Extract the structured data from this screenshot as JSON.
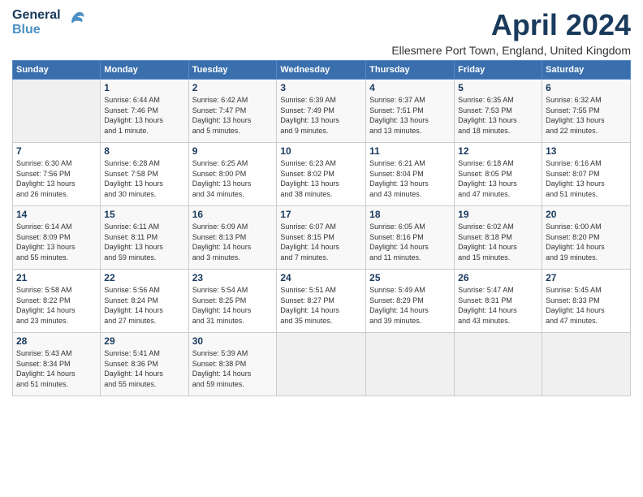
{
  "header": {
    "logo_line1": "General",
    "logo_line2": "Blue",
    "title": "April 2024",
    "location": "Ellesmere Port Town, England, United Kingdom"
  },
  "days_of_week": [
    "Sunday",
    "Monday",
    "Tuesday",
    "Wednesday",
    "Thursday",
    "Friday",
    "Saturday"
  ],
  "weeks": [
    [
      {
        "day": "",
        "info": ""
      },
      {
        "day": "1",
        "info": "Sunrise: 6:44 AM\nSunset: 7:46 PM\nDaylight: 13 hours\nand 1 minute."
      },
      {
        "day": "2",
        "info": "Sunrise: 6:42 AM\nSunset: 7:47 PM\nDaylight: 13 hours\nand 5 minutes."
      },
      {
        "day": "3",
        "info": "Sunrise: 6:39 AM\nSunset: 7:49 PM\nDaylight: 13 hours\nand 9 minutes."
      },
      {
        "day": "4",
        "info": "Sunrise: 6:37 AM\nSunset: 7:51 PM\nDaylight: 13 hours\nand 13 minutes."
      },
      {
        "day": "5",
        "info": "Sunrise: 6:35 AM\nSunset: 7:53 PM\nDaylight: 13 hours\nand 18 minutes."
      },
      {
        "day": "6",
        "info": "Sunrise: 6:32 AM\nSunset: 7:55 PM\nDaylight: 13 hours\nand 22 minutes."
      }
    ],
    [
      {
        "day": "7",
        "info": "Sunrise: 6:30 AM\nSunset: 7:56 PM\nDaylight: 13 hours\nand 26 minutes."
      },
      {
        "day": "8",
        "info": "Sunrise: 6:28 AM\nSunset: 7:58 PM\nDaylight: 13 hours\nand 30 minutes."
      },
      {
        "day": "9",
        "info": "Sunrise: 6:25 AM\nSunset: 8:00 PM\nDaylight: 13 hours\nand 34 minutes."
      },
      {
        "day": "10",
        "info": "Sunrise: 6:23 AM\nSunset: 8:02 PM\nDaylight: 13 hours\nand 38 minutes."
      },
      {
        "day": "11",
        "info": "Sunrise: 6:21 AM\nSunset: 8:04 PM\nDaylight: 13 hours\nand 43 minutes."
      },
      {
        "day": "12",
        "info": "Sunrise: 6:18 AM\nSunset: 8:05 PM\nDaylight: 13 hours\nand 47 minutes."
      },
      {
        "day": "13",
        "info": "Sunrise: 6:16 AM\nSunset: 8:07 PM\nDaylight: 13 hours\nand 51 minutes."
      }
    ],
    [
      {
        "day": "14",
        "info": "Sunrise: 6:14 AM\nSunset: 8:09 PM\nDaylight: 13 hours\nand 55 minutes."
      },
      {
        "day": "15",
        "info": "Sunrise: 6:11 AM\nSunset: 8:11 PM\nDaylight: 13 hours\nand 59 minutes."
      },
      {
        "day": "16",
        "info": "Sunrise: 6:09 AM\nSunset: 8:13 PM\nDaylight: 14 hours\nand 3 minutes."
      },
      {
        "day": "17",
        "info": "Sunrise: 6:07 AM\nSunset: 8:15 PM\nDaylight: 14 hours\nand 7 minutes."
      },
      {
        "day": "18",
        "info": "Sunrise: 6:05 AM\nSunset: 8:16 PM\nDaylight: 14 hours\nand 11 minutes."
      },
      {
        "day": "19",
        "info": "Sunrise: 6:02 AM\nSunset: 8:18 PM\nDaylight: 14 hours\nand 15 minutes."
      },
      {
        "day": "20",
        "info": "Sunrise: 6:00 AM\nSunset: 8:20 PM\nDaylight: 14 hours\nand 19 minutes."
      }
    ],
    [
      {
        "day": "21",
        "info": "Sunrise: 5:58 AM\nSunset: 8:22 PM\nDaylight: 14 hours\nand 23 minutes."
      },
      {
        "day": "22",
        "info": "Sunrise: 5:56 AM\nSunset: 8:24 PM\nDaylight: 14 hours\nand 27 minutes."
      },
      {
        "day": "23",
        "info": "Sunrise: 5:54 AM\nSunset: 8:25 PM\nDaylight: 14 hours\nand 31 minutes."
      },
      {
        "day": "24",
        "info": "Sunrise: 5:51 AM\nSunset: 8:27 PM\nDaylight: 14 hours\nand 35 minutes."
      },
      {
        "day": "25",
        "info": "Sunrise: 5:49 AM\nSunset: 8:29 PM\nDaylight: 14 hours\nand 39 minutes."
      },
      {
        "day": "26",
        "info": "Sunrise: 5:47 AM\nSunset: 8:31 PM\nDaylight: 14 hours\nand 43 minutes."
      },
      {
        "day": "27",
        "info": "Sunrise: 5:45 AM\nSunset: 8:33 PM\nDaylight: 14 hours\nand 47 minutes."
      }
    ],
    [
      {
        "day": "28",
        "info": "Sunrise: 5:43 AM\nSunset: 8:34 PM\nDaylight: 14 hours\nand 51 minutes."
      },
      {
        "day": "29",
        "info": "Sunrise: 5:41 AM\nSunset: 8:36 PM\nDaylight: 14 hours\nand 55 minutes."
      },
      {
        "day": "30",
        "info": "Sunrise: 5:39 AM\nSunset: 8:38 PM\nDaylight: 14 hours\nand 59 minutes."
      },
      {
        "day": "",
        "info": ""
      },
      {
        "day": "",
        "info": ""
      },
      {
        "day": "",
        "info": ""
      },
      {
        "day": "",
        "info": ""
      }
    ]
  ]
}
